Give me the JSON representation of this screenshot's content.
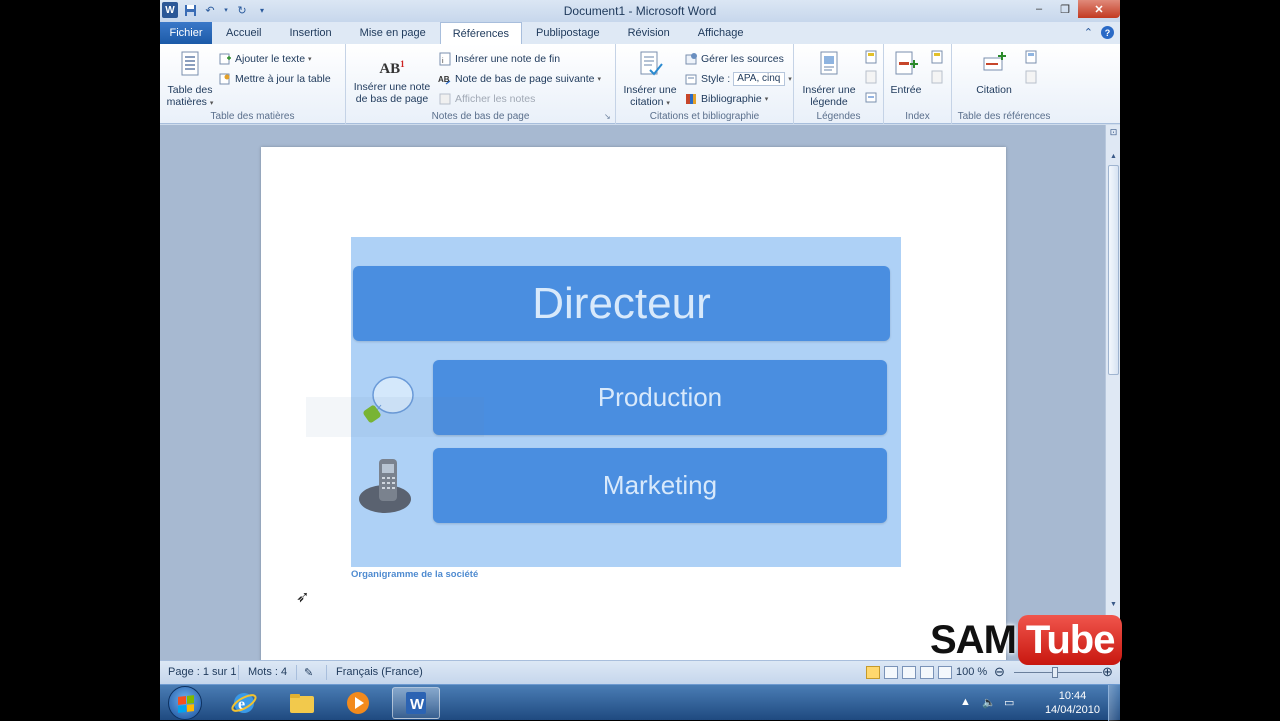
{
  "window": {
    "title": "Document1 - Microsoft Word",
    "controls": [
      "–",
      "❐",
      "✕"
    ]
  },
  "tabs": [
    {
      "label": "Fichier"
    },
    {
      "label": "Accueil"
    },
    {
      "label": "Insertion"
    },
    {
      "label": "Mise en page"
    },
    {
      "label": "Références"
    },
    {
      "label": "Publipostage"
    },
    {
      "label": "Révision"
    },
    {
      "label": "Affichage"
    }
  ],
  "ribbon": {
    "toc": {
      "big_label_1": "Table des",
      "big_label_2": "matières",
      "add_text": "Ajouter le texte",
      "update_table": "Mettre à jour la table",
      "group": "Table des matières"
    },
    "footnotes": {
      "big_label_1": "Insérer une note",
      "big_label_2": "de bas de page",
      "icon_text": "AB",
      "icon_sup": "1",
      "insert_endnote": "Insérer une note de fin",
      "next_footnote": "Note de bas de page suivante",
      "show_notes": "Afficher les notes",
      "group": "Notes de bas de page"
    },
    "citations": {
      "big_label_1": "Insérer une",
      "big_label_2": "citation",
      "manage_sources": "Gérer les sources",
      "style_label": "Style :",
      "style_value": "APA, cinq",
      "bibliography": "Bibliographie",
      "group": "Citations et bibliographie"
    },
    "captions": {
      "big_label_1": "Insérer une",
      "big_label_2": "légende",
      "group": "Légendes"
    },
    "index": {
      "big_label": "Entrée",
      "group": "Index"
    },
    "toa": {
      "big_label": "Citation",
      "group": "Table des références"
    }
  },
  "document": {
    "director": "Directeur",
    "production": "Production",
    "marketing": "Marketing",
    "caption": "Organigramme de la société"
  },
  "status": {
    "page": "Page : 1 sur 1",
    "words": "Mots : 4",
    "language": "Français (France)",
    "zoom": "100 %"
  },
  "watermark": {
    "sam": "SAM",
    "tube": "Tube"
  },
  "taskbar": {
    "time": "10:44",
    "date": "14/04/2010"
  },
  "colors": {
    "diagram_bg": "#aed1f6",
    "box": "#4a8ee0",
    "box_text": "#d8e9fb",
    "caption": "#4f8bd0",
    "file_tab": "#2b63b3"
  }
}
